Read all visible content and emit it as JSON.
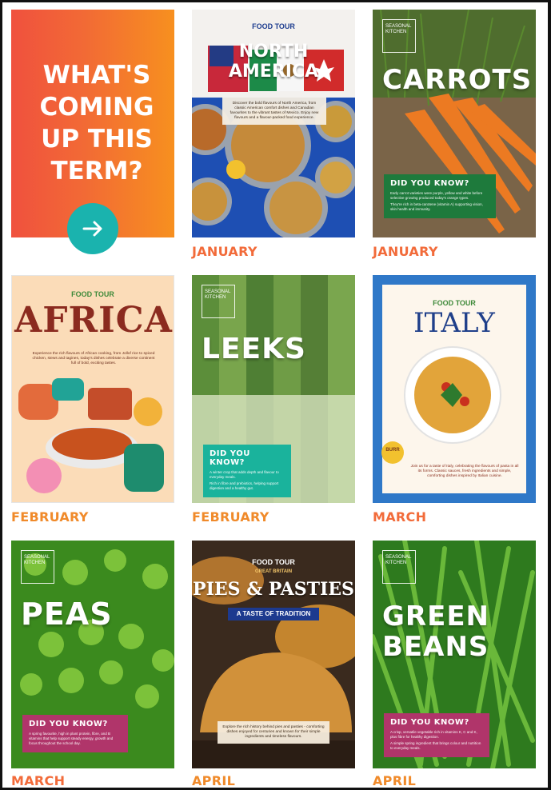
{
  "hero": {
    "title": "WHAT'S COMING UP THIS TERM?",
    "arrow_icon": "arrow-right-icon"
  },
  "colors": {
    "month_text": "#f26b3a",
    "teal": "#1ab3ae",
    "dyk_green": "#1e7a3c",
    "dyk_pink": "#b0356a"
  },
  "cards": [
    {
      "label": "FOOD TOUR",
      "title": "NORTH AMERICA",
      "month": "JANUARY",
      "blurb": "Discover the bold flavours of North America, from classic American comfort dishes and Canadian favourites to the vibrant tastes of Mexico. Enjoy new flavours and a flavour-packed food experience."
    },
    {
      "badge": "SEASONAL KITCHEN",
      "title": "CARROTS",
      "month": "JANUARY",
      "dyk_title": "DID YOU KNOW?",
      "dyk_text_1": "Early carrot varieties were purple, yellow and white before selective growing produced today's orange types.",
      "dyk_text_2": "They're rich in beta-carotene (vitamin A) supporting vision, skin health and immunity."
    },
    {
      "label": "FOOD TOUR",
      "title": "AFRICA",
      "month": "FEBRUARY",
      "blurb": "Experience the rich flavours of African cooking, from Jollof rice to spiced chicken, stews and tagines, today's dishes celebrate a diverse continent full of bold, exciting tastes."
    },
    {
      "badge": "SEASONAL KITCHEN",
      "title": "LEEKS",
      "month": "FEBRUARY",
      "dyk_title": "DID YOU KNOW?",
      "dyk_text_1": "A winter crop that adds depth and flavour to everyday meals.",
      "dyk_text_2": "Rich in fibre and prebiotics, helping support digestion and a healthy gut."
    },
    {
      "label": "FOOD TOUR",
      "title": "ITALY",
      "month": "MARCH",
      "tag": "BURR",
      "blurb": "Join us for a taste of Italy, celebrating the flavours of pasta in all its forms. Classic sauces, fresh ingredients and simple, comforting dishes inspired by Italian cuisine."
    },
    {
      "badge": "SEASONAL KITCHEN",
      "title": "PEAS",
      "month": "MARCH",
      "dyk_title": "DID YOU KNOW?",
      "dyk_text_1": "A spring favourite, high in plant protein, fibre, and B vitamins that help support steady energy, growth and focus throughout the school day."
    },
    {
      "label": "FOOD TOUR",
      "sub_label": "GREAT BRITAIN",
      "title": "PIES & PASTIES",
      "ribbon": "A TASTE OF TRADITION",
      "month": "APRIL",
      "blurb": "Explore the rich history behind pies and pasties - comforting dishes enjoyed for centuries and known for their simple ingredients and timeless flavours."
    },
    {
      "badge": "SEASONAL KITCHEN",
      "title": "GREEN BEANS",
      "month": "APRIL",
      "dyk_title": "DID YOU KNOW?",
      "dyk_text_1": "A crisp, versatile vegetable rich in vitamins K, C and K, plus fibre for healthy digestion.",
      "dyk_text_2": "A simple spring ingredient that brings colour and nutrition to everyday meals."
    }
  ]
}
